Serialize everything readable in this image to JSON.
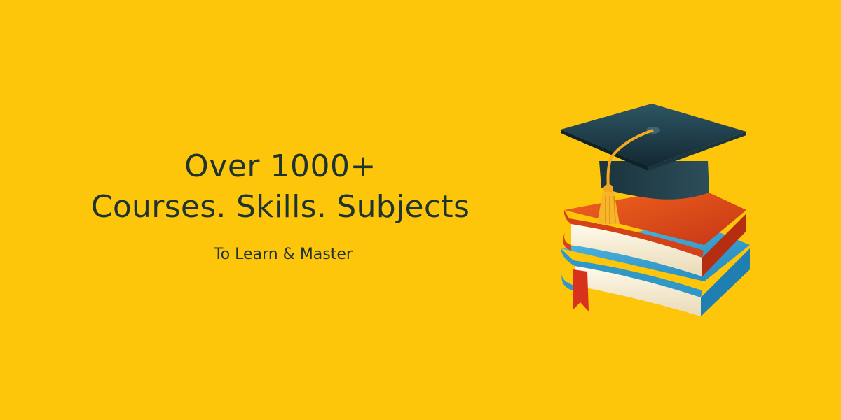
{
  "banner": {
    "headline_line1": "Over 1000+",
    "headline_line2": "Courses. Skills. Subjects",
    "tagline": "To Learn & Master"
  },
  "illustration": {
    "icons": [
      "graduation-cap-icon",
      "book-stack-icon"
    ]
  },
  "colors": {
    "background": "#FDC60B",
    "text": "#1F3330",
    "cap": "#1E3A45",
    "tassel": "#F4A81E",
    "book_top_cover": "#E8531C",
    "book_bottom_cover": "#3AA6D6",
    "bookmark": "#D8321C",
    "pages": "#FBF3DE"
  }
}
